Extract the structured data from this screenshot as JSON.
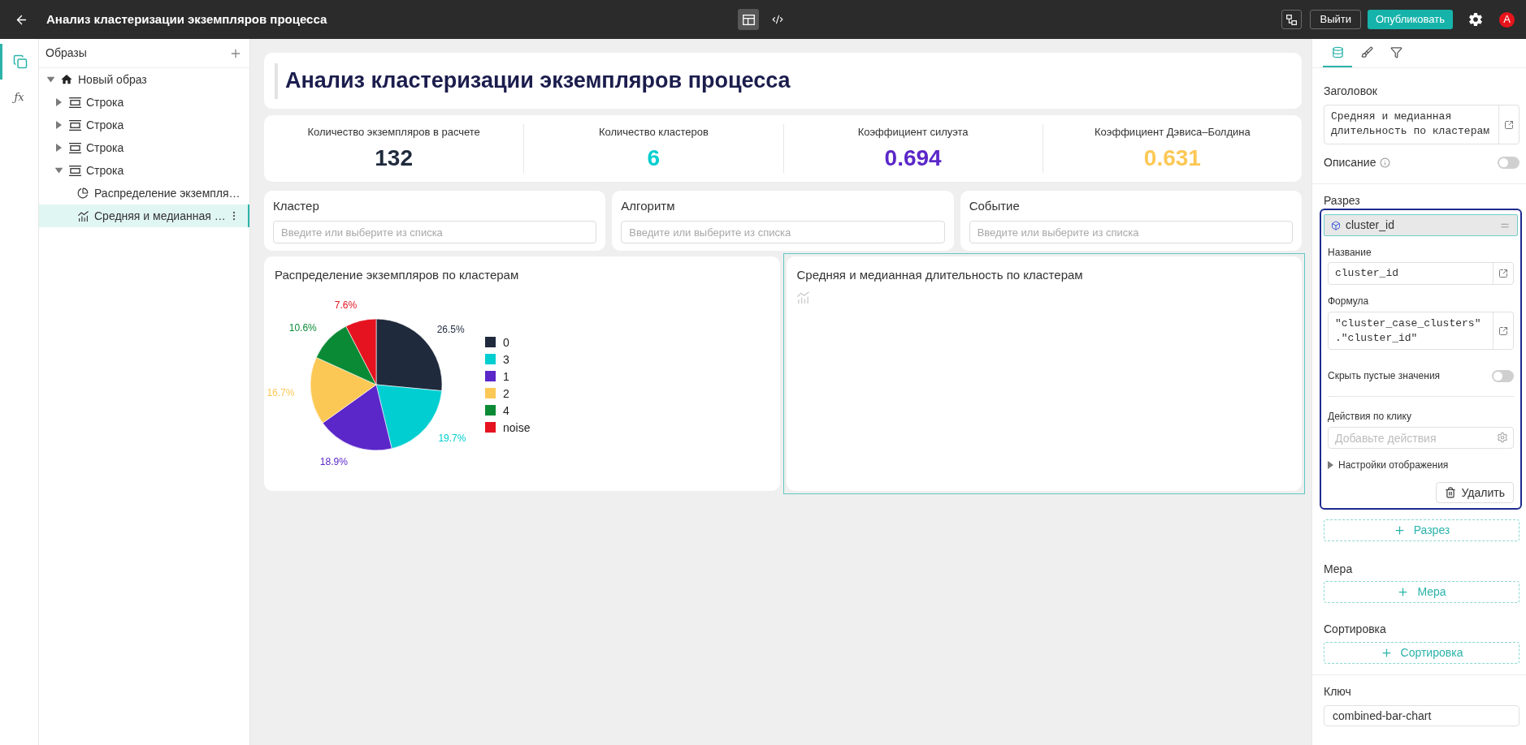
{
  "top_bar": {
    "title": "Анализ кластеризации экземпляров процесса",
    "view_modes": [
      {
        "kind": "layout",
        "selected": true
      },
      {
        "kind": "code",
        "selected": false
      }
    ],
    "exit_button": "Выйти",
    "publish_button": "Опубликовать",
    "avatar": "A"
  },
  "rail": [
    {
      "kind": "pages",
      "selected": true
    },
    {
      "kind": "formula",
      "label": "ƒx",
      "selected": false
    }
  ],
  "tree": {
    "header": "Образы",
    "items": [
      {
        "kind": "page",
        "label": "Новый образ",
        "expanded": true,
        "selected": false,
        "children": [
          {
            "kind": "row",
            "label": "Строка",
            "expanded": false,
            "selected": false
          },
          {
            "kind": "row",
            "label": "Строка",
            "expanded": false,
            "selected": false
          },
          {
            "kind": "row",
            "label": "Строка",
            "expanded": false,
            "selected": false
          },
          {
            "kind": "row",
            "label": "Строка",
            "expanded": true,
            "selected": false,
            "children": [
              {
                "kind": "pie",
                "label": "Распределение экземпля…",
                "selected": false
              },
              {
                "kind": "chart",
                "label": "Средняя и медианная …",
                "selected": true
              }
            ]
          }
        ]
      }
    ]
  },
  "dashboard": {
    "title": "Анализ кластеризации экземпляров процесса",
    "kpis": [
      {
        "label": "Количество экземпляров в расчете",
        "value": "132",
        "color": "#1f2a3c"
      },
      {
        "label": "Количество кластеров",
        "value": "6",
        "color": "#00ced1"
      },
      {
        "label": "Коэффициент силуэта",
        "value": "0.694",
        "color": "#5b27c9"
      },
      {
        "label": "Коэффициент Дэвиса–Болдина",
        "value": "0.631",
        "color": "#fcc855"
      }
    ],
    "filters": [
      {
        "label": "Кластер",
        "placeholder": "Введите или выберите из списка"
      },
      {
        "label": "Алгоритм",
        "placeholder": "Введите или выберите из списка"
      },
      {
        "label": "Событие",
        "placeholder": "Введите или выберите из списка"
      }
    ],
    "charts": [
      {
        "kind": "pie",
        "title": "Распределение экземпляров по кластерам",
        "selected": false,
        "slices": [
          {
            "color": "#1f2a3c"
          },
          {
            "color": "#00ced1"
          },
          {
            "color": "#5b27c9"
          },
          {
            "color": "#fcc855"
          },
          {
            "color": "#0b8a36"
          },
          {
            "color": "#e5131f"
          }
        ],
        "chart_data": {
          "type": "pie",
          "categories": [
            "0",
            "3",
            "1",
            "2",
            "4",
            "noise"
          ],
          "values": [
            26.5,
            19.7,
            18.9,
            16.7,
            10.6,
            7.6
          ],
          "value_labels": [
            "26.5%",
            "19.7%",
            "18.9%",
            "16.7%",
            "10.6%",
            "7.6%"
          ],
          "legend": "right"
        }
      },
      {
        "kind": "combined_bar",
        "title": "Средняя и медианная длительность по кластерам",
        "selected": true
      }
    ]
  },
  "properties": {
    "tabs": [
      {
        "kind": "data",
        "selected": true
      },
      {
        "kind": "style",
        "selected": false
      },
      {
        "kind": "filter",
        "selected": false
      }
    ],
    "title_field": {
      "label": "Заголовок",
      "value": "Средняя и медианная длительность по кластерам"
    },
    "description": {
      "label": "Описание",
      "on": false
    },
    "dimensions": {
      "label": "Разрез",
      "items": [
        {
          "name": "cluster_id",
          "name_field": {
            "label": "Название",
            "value": "cluster_id"
          },
          "formula_field": {
            "label": "Формула",
            "value": "\"cluster_case_clusters\".\"cluster_id\""
          },
          "hide_empty": {
            "label": "Скрыть пустые значения",
            "on": false
          },
          "click_actions": {
            "label": "Действия по клику",
            "placeholder": "Добавьте действия"
          },
          "display_settings": {
            "label": "Настройки отображения",
            "expanded": false
          },
          "delete_button": "Удалить"
        }
      ],
      "add_button": "Разрез"
    },
    "measures": {
      "label": "Мера",
      "add_button": "Мера"
    },
    "sorting": {
      "label": "Сортировка",
      "add_button": "Сортировка"
    },
    "key_field": {
      "label": "Ключ",
      "value": "combined-bar-chart"
    }
  }
}
